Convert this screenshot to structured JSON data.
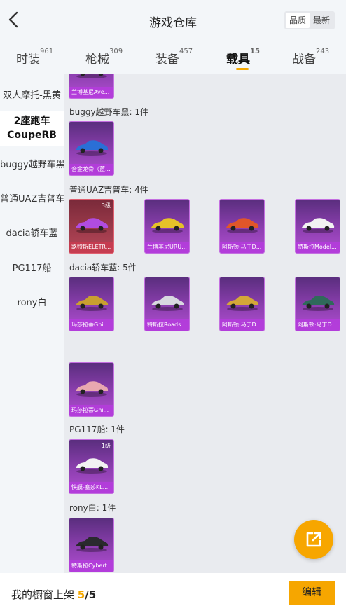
{
  "header": {
    "title": "游戏仓库",
    "sort_options": [
      "品质",
      "最新"
    ],
    "sort_selected": "品质"
  },
  "tabs": [
    {
      "label": "时装",
      "count": "961"
    },
    {
      "label": "枪械",
      "count": "309"
    },
    {
      "label": "装备",
      "count": "457"
    },
    {
      "label": "载具",
      "count": "15",
      "active": true
    },
    {
      "label": "战备",
      "count": "243"
    }
  ],
  "sidebar": {
    "items": [
      {
        "label": "双人摩托-黑黄"
      },
      {
        "label": "2座跑车",
        "label2": "CoupeRB",
        "selected": true
      },
      {
        "label": "buggy越野车黑"
      },
      {
        "label": "普通UAZ吉普车"
      },
      {
        "label": "dacia轿车蓝"
      },
      {
        "label": "PG117船"
      },
      {
        "label": "rony白"
      }
    ]
  },
  "groups": [
    {
      "label": "",
      "cards": [
        {
          "caption": "兰博基尼Ave...",
          "car_color": "#e8c24a"
        }
      ]
    },
    {
      "label": "buggy越野车黑: 1件",
      "cards": [
        {
          "caption": "合金龙骨（蓝...",
          "car_color": "#2a6fd6"
        }
      ]
    },
    {
      "label": "普通UAZ吉普车: 4件",
      "cards": [
        {
          "caption": "路特斯ELETR...",
          "level": "3级",
          "rarity": "red",
          "car_color": "#b04ce0"
        },
        {
          "caption": "兰博基尼URU...",
          "car_color": "#e6c229"
        },
        {
          "caption": "阿斯顿·马丁D...",
          "car_color": "#e0562a"
        },
        {
          "caption": "特斯拉Model...",
          "car_color": "#f2f2f2"
        }
      ]
    },
    {
      "label": "dacia轿车蓝: 5件",
      "cards": [
        {
          "caption": "玛莎拉蒂Ghi...",
          "car_color": "#c9a030"
        },
        {
          "caption": "特斯拉Roads...",
          "car_color": "#d8d8e0"
        },
        {
          "caption": "阿斯顿·马丁D...",
          "car_color": "#d4a838"
        },
        {
          "caption": "阿斯顿·马丁D...",
          "car_color": "#2f6a5a"
        },
        {
          "caption": "玛莎拉蒂Ghi...",
          "car_color": "#e8a8b0"
        }
      ]
    },
    {
      "label": "PG117船: 1件",
      "cards": [
        {
          "caption": "快艇-塞莎KL...",
          "level": "1级",
          "car_color": "#f2f2f2"
        }
      ]
    },
    {
      "label": "rony白: 1件",
      "cards": [
        {
          "caption": "特斯拉Cybert...",
          "car_color": "#2a2a2e"
        }
      ]
    }
  ],
  "footer": {
    "shelf_label": "我的橱窗上架",
    "shelf_count": "5",
    "shelf_total": "/5",
    "edit_label": "编辑"
  },
  "colors": {
    "accent": "#f6a600",
    "card_epic": "#b04ed0",
    "card_legend": "#b8485a"
  },
  "icons": {
    "back": "back-chevron-icon",
    "fab": "share-export-icon"
  }
}
